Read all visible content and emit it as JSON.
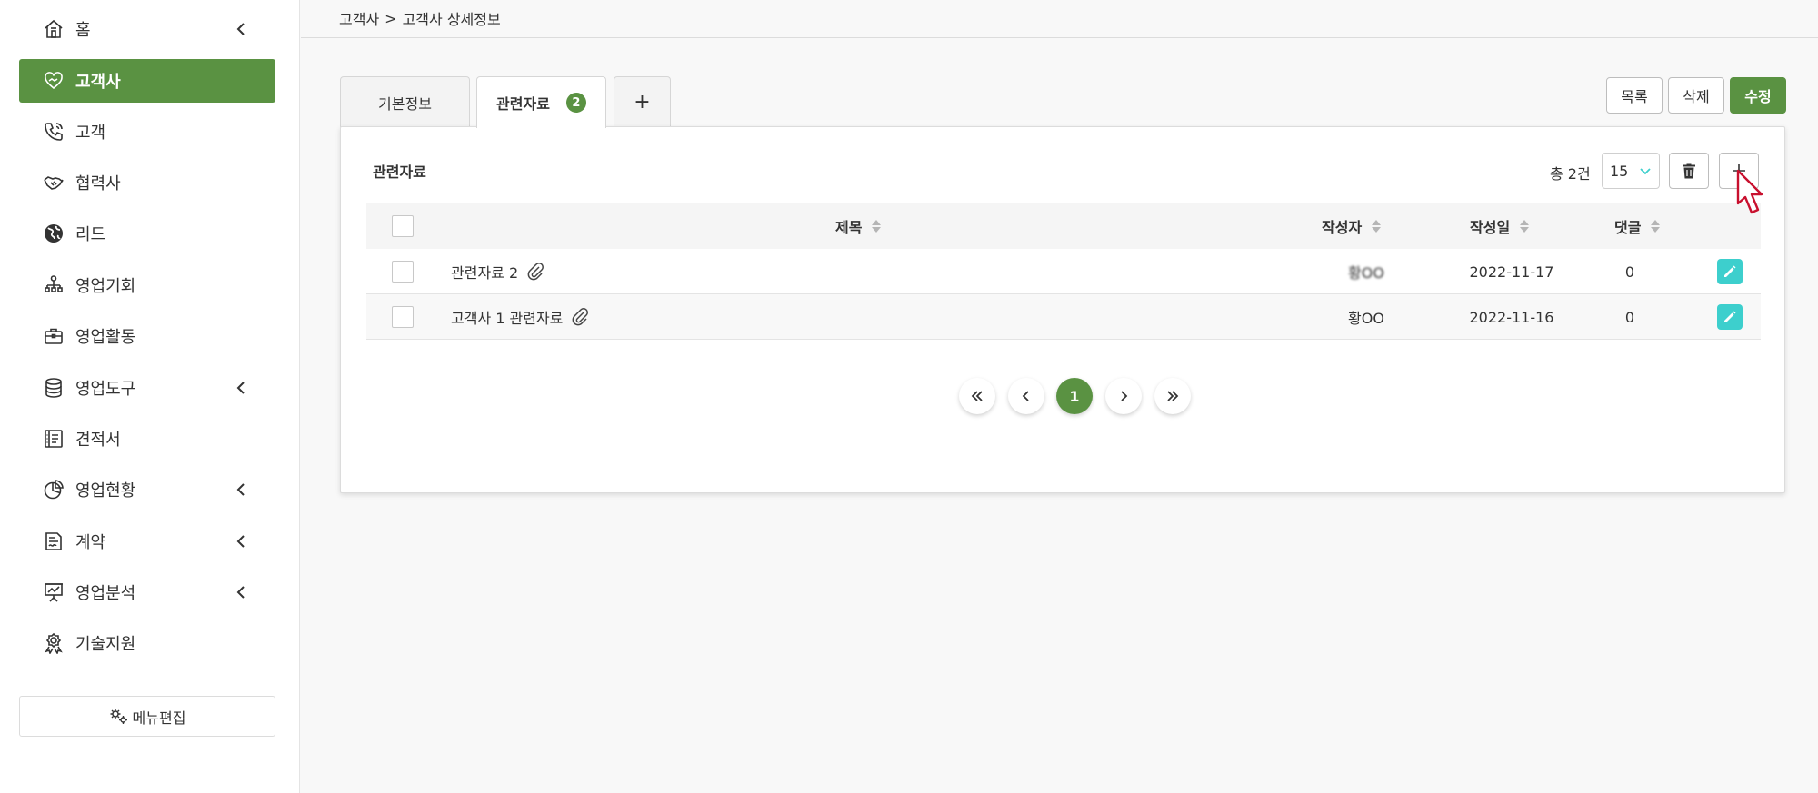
{
  "sidebar": {
    "items": [
      {
        "label": "홈",
        "icon": "home-icon",
        "chevron": true,
        "active": false
      },
      {
        "label": "고객사",
        "icon": "handshake-heart-icon",
        "chevron": false,
        "active": true
      },
      {
        "label": "고객",
        "icon": "phone-icon",
        "chevron": false,
        "active": false
      },
      {
        "label": "협력사",
        "icon": "handshake-icon",
        "chevron": false,
        "active": false
      },
      {
        "label": "리드",
        "icon": "globe-icon",
        "chevron": false,
        "active": false
      },
      {
        "label": "영업기회",
        "icon": "org-chart-icon",
        "chevron": false,
        "active": false
      },
      {
        "label": "영업활동",
        "icon": "briefcase-icon",
        "chevron": false,
        "active": false
      },
      {
        "label": "영업도구",
        "icon": "database-icon",
        "chevron": true,
        "active": false
      },
      {
        "label": "견적서",
        "icon": "invoice-icon",
        "chevron": false,
        "active": false
      },
      {
        "label": "영업현황",
        "icon": "pie-chart-icon",
        "chevron": true,
        "active": false
      },
      {
        "label": "계약",
        "icon": "contract-icon",
        "chevron": true,
        "active": false
      },
      {
        "label": "영업분석",
        "icon": "presentation-icon",
        "chevron": true,
        "active": false
      },
      {
        "label": "기술지원",
        "icon": "support-icon",
        "chevron": false,
        "active": false
      }
    ],
    "menu_edit_label": "메뉴편집"
  },
  "breadcrumb": {
    "parent": "고객사",
    "separator": ">",
    "current": "고객사 상세정보"
  },
  "tabs": [
    {
      "label": "기본정보",
      "active": false
    },
    {
      "label": "관련자료",
      "active": true,
      "badge": "2"
    },
    {
      "label": "+",
      "active": false
    }
  ],
  "actions": {
    "list_label": "목록",
    "delete_label": "삭제",
    "edit_label": "수정"
  },
  "panel": {
    "title": "관련자료",
    "total_text": "총 2건",
    "page_size": "15"
  },
  "table": {
    "columns": [
      "제목",
      "작성자",
      "작성일",
      "댓글"
    ],
    "rows": [
      {
        "title": "관련자료 2",
        "author": "황OO",
        "date": "2022-11-17",
        "comments": "0"
      },
      {
        "title": "고객사 1 관련자료",
        "author": "황OO",
        "date": "2022-11-16",
        "comments": "0"
      }
    ]
  },
  "pagination": {
    "current_page": "1"
  },
  "colors": {
    "accent_green": "#5a9242",
    "edit_teal": "#3dcfcd"
  }
}
